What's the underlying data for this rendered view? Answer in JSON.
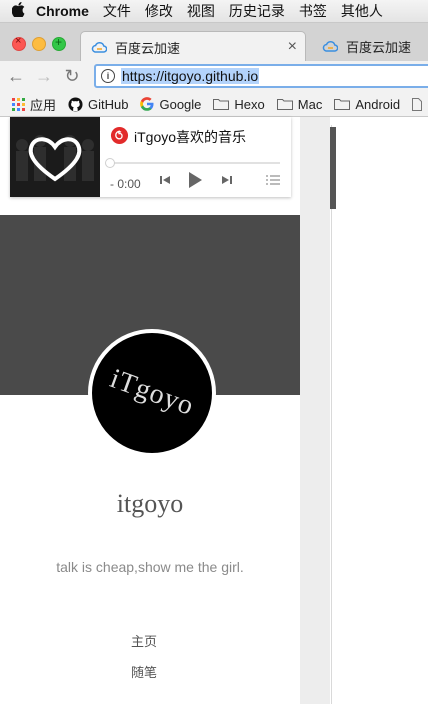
{
  "menubar": {
    "app": "Chrome",
    "items": [
      "文件",
      "修改",
      "视图",
      "历史记录",
      "书签",
      "其他人"
    ]
  },
  "tabs": [
    {
      "title": "百度云加速",
      "active": true
    },
    {
      "title": "百度云加速",
      "active": false
    }
  ],
  "toolbar": {
    "url": "https://itgoyo.github.io"
  },
  "bookmarks": [
    {
      "label": "应用",
      "icon": "apps-grid-icon"
    },
    {
      "label": "GitHub",
      "icon": "github-icon"
    },
    {
      "label": "Google",
      "icon": "google-icon"
    },
    {
      "label": "Hexo",
      "icon": "folder-icon"
    },
    {
      "label": "Mac",
      "icon": "folder-icon"
    },
    {
      "label": "Android",
      "icon": "folder-icon"
    }
  ],
  "player": {
    "title": "iTgoyo喜欢的音乐",
    "time": "- 0:00",
    "progress": 0
  },
  "profile": {
    "avatar_text": "iTgoyo",
    "name": "itgoyo",
    "motto": "talk is cheap,show me the girl."
  },
  "nav": [
    "主页",
    "随笔"
  ],
  "colors": {
    "banner": "#4a4a4a",
    "netease_red": "#e22b2b",
    "url_highlight": "#b3d3fb"
  }
}
